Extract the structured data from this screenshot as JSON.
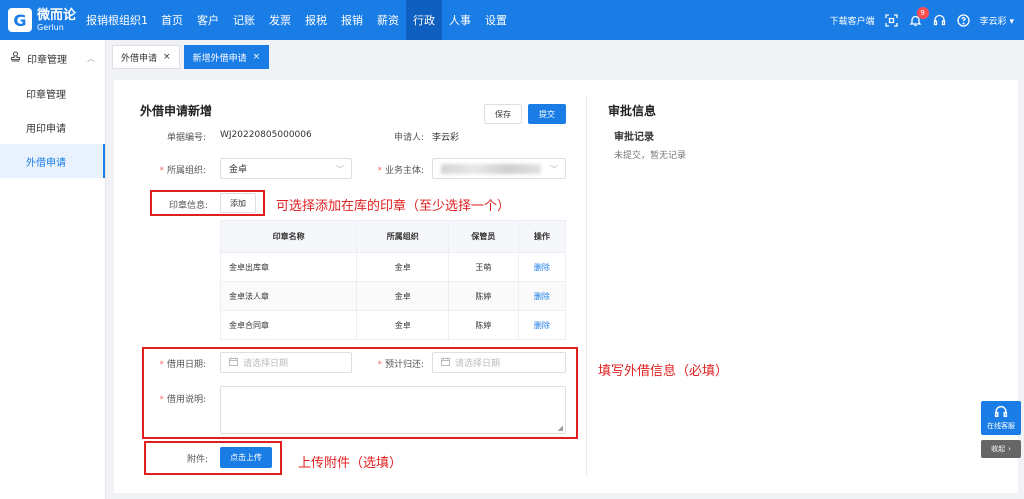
{
  "topbar": {
    "logo_cn": "微而论",
    "logo_en": "Gerlun",
    "org": "报销根组织1",
    "nav": [
      "首页",
      "客户",
      "记账",
      "发票",
      "报税",
      "报销",
      "薪资",
      "行政",
      "人事",
      "设置"
    ],
    "active_nav": 7,
    "download": "下载客户端",
    "badge_count": "9",
    "user": "李云彩"
  },
  "sidebar": {
    "group": "印章管理",
    "items": [
      "印章管理",
      "用印申请",
      "外借申请"
    ],
    "active": 2
  },
  "tabs": [
    {
      "label": "外借申请",
      "active": false
    },
    {
      "label": "新增外借申请",
      "active": true
    }
  ],
  "form": {
    "title": "外借申请新增",
    "save": "保存",
    "submit": "提交",
    "doc_no_label": "单据编号:",
    "doc_no": "WJ20220805000006",
    "applicant_label": "申请人:",
    "applicant": "李云彩",
    "org_label": "所属组织:",
    "org_value": "金卓",
    "entity_label": "业务主体:",
    "seal_label": "印章信息:",
    "add": "添加",
    "seal_note": "可选择添加在库的印章（至少选择一个）",
    "table": {
      "headers": [
        "印章名称",
        "所属组织",
        "保管员",
        "操作"
      ],
      "rows": [
        [
          "金卓出库章",
          "金卓",
          "王萌",
          "删除"
        ],
        [
          "金卓法人章",
          "金卓",
          "陈婷",
          "删除"
        ],
        [
          "金卓合同章",
          "金卓",
          "陈婷",
          "删除"
        ]
      ]
    },
    "borrow_date_label": "借用日期:",
    "borrow_date_placeholder": "请选择日期",
    "return_date_label": "预计归还:",
    "return_date_placeholder": "请选择日期",
    "desc_label": "借用说明:",
    "borrow_note": "填写外借信息（必填）",
    "attach_label": "附件:",
    "upload": "点击上传",
    "attach_note": "上传附件（选填）"
  },
  "approval": {
    "title": "审批信息",
    "records": "审批记录",
    "empty": "未提交，暂无记录"
  },
  "floating": {
    "service": "在线客服",
    "collapse": "收起"
  }
}
